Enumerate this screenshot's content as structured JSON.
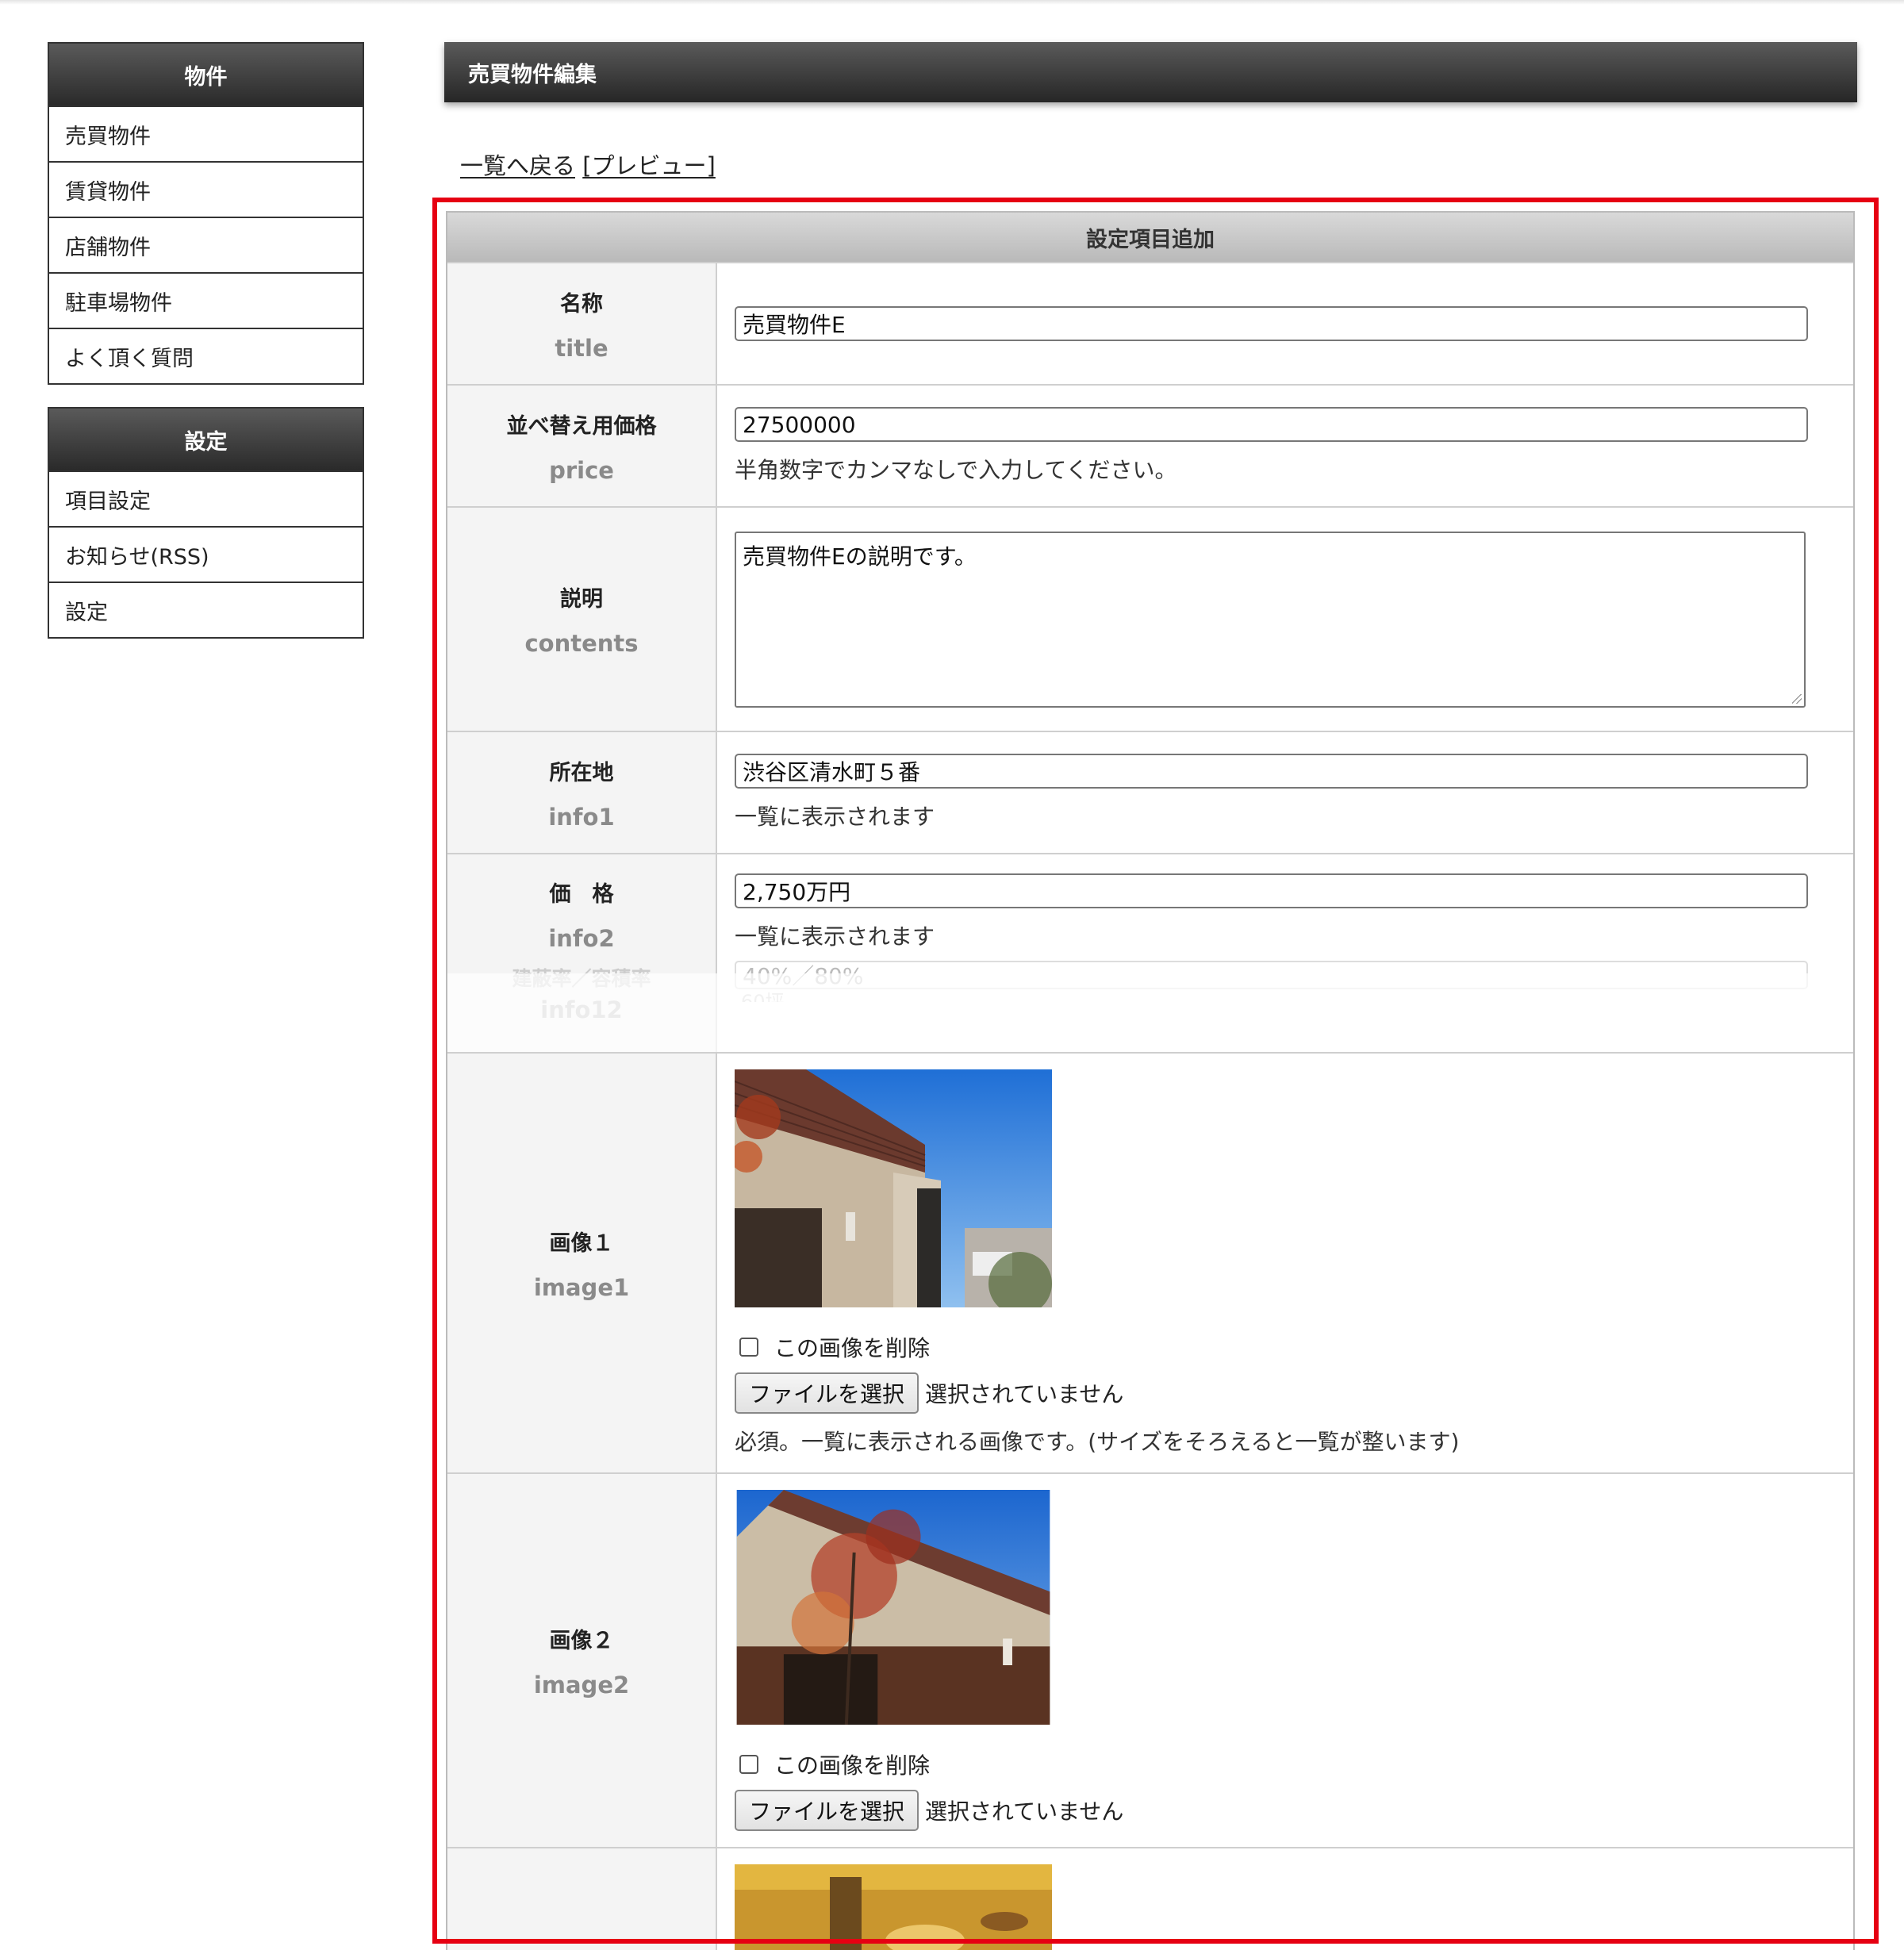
{
  "sidebar": {
    "groups": [
      {
        "heading": "物件",
        "items": [
          "売買物件",
          "賃貸物件",
          "店舗物件",
          "駐車場物件",
          "よく頂く質問"
        ]
      },
      {
        "heading": "設定",
        "items": [
          "項目設定",
          "お知らせ(RSS)",
          "設定"
        ]
      }
    ]
  },
  "main": {
    "title": "売買物件編集",
    "back_link": "一覧へ戻る",
    "preview_link": "[プレビュー]"
  },
  "form": {
    "heading": "設定項目追加",
    "fields": {
      "title": {
        "label": "名称",
        "key": "title",
        "value": "売買物件E"
      },
      "price": {
        "label": "並べ替え用価格",
        "key": "price",
        "value": "27500000",
        "note": "半角数字でカンマなしで入力してください。"
      },
      "contents": {
        "label": "説明",
        "key": "contents",
        "value": "売買物件Eの説明です。"
      },
      "info1": {
        "label": "所在地",
        "key": "info1",
        "value": "渋谷区清水町５番",
        "note": "一覧に表示されます"
      },
      "info2": {
        "label": "価　格",
        "key": "info2",
        "value": "2,750万円",
        "note": "一覧に表示されます"
      },
      "info12": {
        "label": "建蔽率／容積率",
        "key": "info12",
        "value": "40%／80%",
        "value2": "60坪"
      },
      "image1": {
        "label": "画像１",
        "key": "image1",
        "delete_label": "この画像を削除",
        "file_button": "ファイルを選択",
        "file_status": "選択されていません",
        "note": "必須。一覧に表示される画像です。(サイズをそろえると一覧が整います)"
      },
      "image2": {
        "label": "画像２",
        "key": "image2",
        "delete_label": "この画像を削除",
        "file_button": "ファイルを選択",
        "file_status": "選択されていません"
      }
    }
  },
  "colors": {
    "highlight_border": "#e60012",
    "header_dark": "#333333"
  }
}
